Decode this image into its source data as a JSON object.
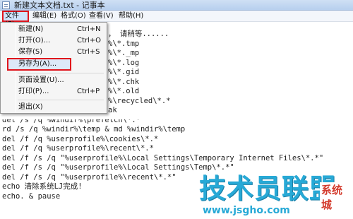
{
  "window": {
    "title": "新建文本文档.txt - 记事本"
  },
  "menubar": {
    "file": "文件(F)",
    "edit": "编辑(E)",
    "format": "格式(O)",
    "view": "查看(V)",
    "help": "帮助(H)"
  },
  "file_menu": {
    "items": [
      {
        "label": "新建(N)",
        "shortcut": "Ctrl+N"
      },
      {
        "label": "打开(O)...",
        "shortcut": "Ctrl+O"
      },
      {
        "label": "保存(S)",
        "shortcut": "Ctrl+S"
      },
      {
        "label": "另存为(A)..."
      },
      {
        "label": "页面设置(U)..."
      },
      {
        "label": "打印(P)...",
        "shortcut": "Ctrl+P"
      },
      {
        "label": "退出(X)"
      }
    ]
  },
  "editor": {
    "lines": [
      "， 请稍等......",
      "%\\*.tmp",
      "%\\*._mp",
      "%\\*.log",
      "%\\*.gid",
      "%\\*.chk",
      "%\\*.old",
      "%\\recycled\\*.*",
      "ak",
      "del /s /q %windir%\\prefetch\\*.*",
      "rd /s /q %windir%\\temp & md %windir%\\temp",
      "del /f /q %userprofile%\\cookies\\*.*",
      "del /f /q %userprofile%\\recent\\*.*",
      "del /f /s /q \"%userprofile%\\Local Settings\\Temporary Internet Files\\*.*\"",
      "del /f /s /q \"%userprofile%\\Local Settings\\Temp\\*.*\"",
      "del /f /s /q \"%userprofile%\\recent\\*.*\"",
      "echo 清除系统LJ完成!",
      "echo. & pause"
    ]
  },
  "watermark": {
    "logo": "技术员联盟",
    "url": "www.jsgho.com",
    "tag": "系统城"
  }
}
